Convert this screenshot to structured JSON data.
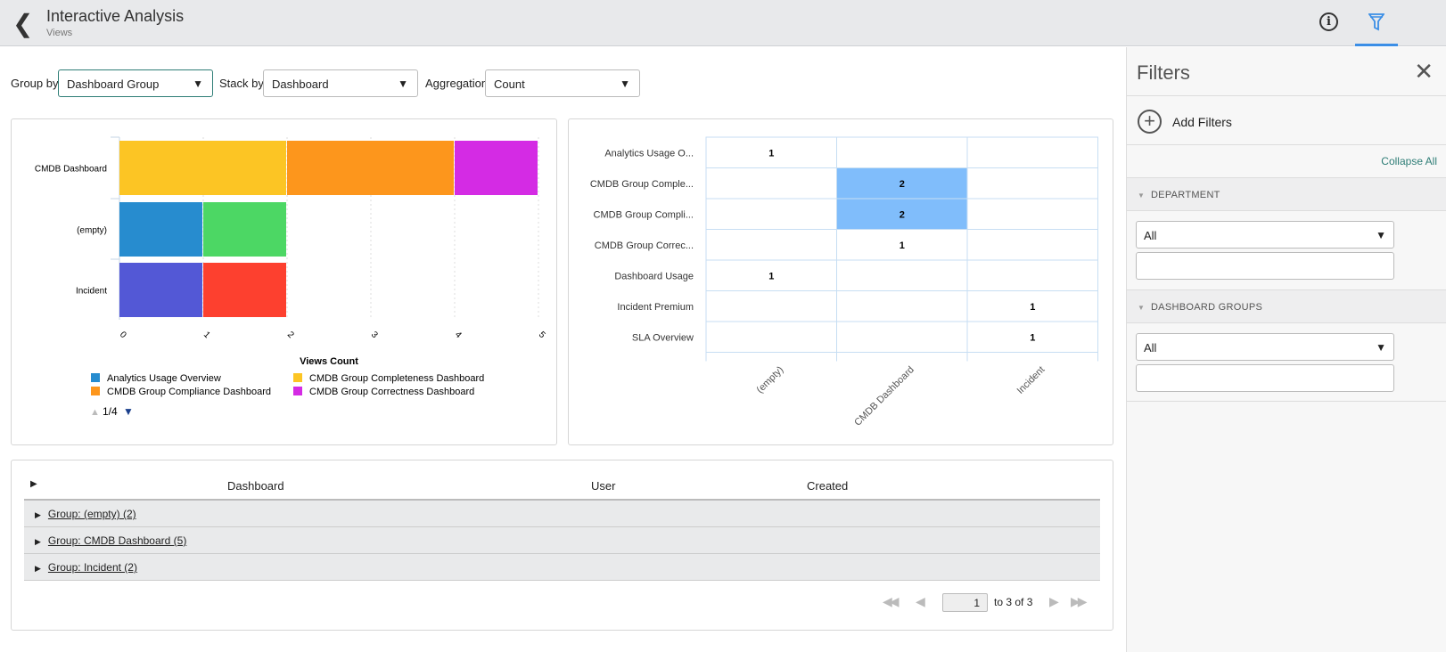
{
  "header": {
    "title": "Interactive Analysis",
    "subtitle": "Views",
    "back_icon": "chevron-left-icon",
    "info_icon": "info-icon",
    "filter_icon": "filter-icon"
  },
  "controls": {
    "group_by_label": "Group by",
    "group_by_value": "Dashboard Group",
    "stack_by_label": "Stack by",
    "stack_by_value": "Dashboard",
    "aggregation_label": "Aggregation",
    "aggregation_value": "Count"
  },
  "chart_data": [
    {
      "type": "bar",
      "orientation": "horizontal",
      "stacked": true,
      "xlabel": "Views Count",
      "xlim": [
        0,
        5
      ],
      "xticks": [
        "0",
        "1",
        "2",
        "3",
        "4",
        "5"
      ],
      "categories": [
        "CMDB Dashboard",
        "(empty)",
        "Incident"
      ],
      "segments": [
        {
          "category": "CMDB Dashboard",
          "series": "CMDB Group Completeness Dashboard",
          "value": 2,
          "color": "#fcc524"
        },
        {
          "category": "CMDB Dashboard",
          "series": "CMDB Group Compliance Dashboard",
          "value": 2,
          "color": "#fd961c"
        },
        {
          "category": "CMDB Dashboard",
          "series": "CMDB Group Correctness Dashboard",
          "value": 1,
          "color": "#d42be4"
        },
        {
          "category": "(empty)",
          "series": "Analytics Usage Overview",
          "value": 1,
          "color": "#278ccf"
        },
        {
          "category": "(empty)",
          "value": 1,
          "color": "#4cd764"
        },
        {
          "category": "Incident",
          "value": 1,
          "color": "#5358d6"
        },
        {
          "category": "Incident",
          "value": 1,
          "color": "#fd402f"
        }
      ],
      "legend": [
        {
          "name": "Analytics Usage Overview",
          "color": "#278ccf"
        },
        {
          "name": "CMDB Group Completeness Dashboard",
          "color": "#fcc524"
        },
        {
          "name": "CMDB Group Compliance Dashboard",
          "color": "#fd961c"
        },
        {
          "name": "CMDB Group Correctness Dashboard",
          "color": "#d42be4"
        }
      ],
      "legend_page": "1/4"
    },
    {
      "type": "heatmap",
      "columns": [
        "(empty)",
        "CMDB Dashboard",
        "Incident"
      ],
      "rows": [
        "Analytics Usage O...",
        "CMDB Group Comple...",
        "CMDB Group Compli...",
        "CMDB Group Correc...",
        "Dashboard Usage",
        "Incident Premium",
        "SLA Overview"
      ],
      "values": [
        [
          1,
          null,
          null
        ],
        [
          null,
          2,
          null
        ],
        [
          null,
          2,
          null
        ],
        [
          null,
          1,
          null
        ],
        [
          1,
          null,
          null
        ],
        [
          null,
          null,
          1
        ],
        [
          null,
          null,
          1
        ]
      ],
      "highlight_color": "#80bdfb"
    }
  ],
  "table": {
    "headers": [
      "Dashboard",
      "User",
      "Created"
    ],
    "groups": [
      "Group: (empty) (2)",
      "Group: CMDB Dashboard (5)",
      "Group: Incident (2)"
    ],
    "pagination": {
      "page": "1",
      "of_text": "to 3 of 3"
    }
  },
  "filters": {
    "title": "Filters",
    "add_label": "Add Filters",
    "collapse_all": "Collapse All",
    "sections": [
      {
        "label": "DEPARTMENT",
        "value": "All"
      },
      {
        "label": "DASHBOARD GROUPS",
        "value": "All"
      }
    ]
  }
}
